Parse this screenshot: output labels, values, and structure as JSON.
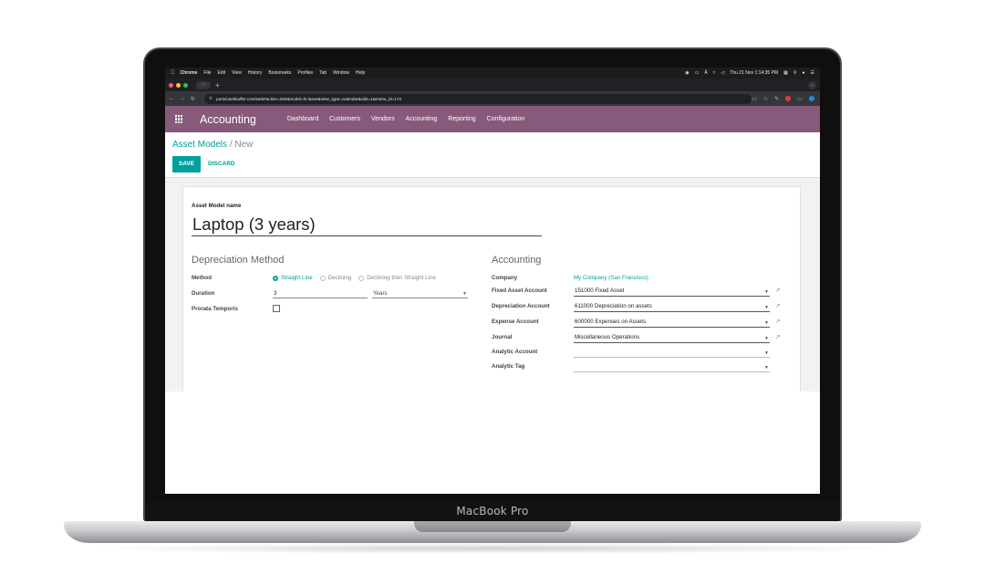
{
  "device": {
    "brand": "MacBook Pro"
  },
  "macos_menubar": {
    "apple_icon": "apple-icon",
    "items": [
      "Chrome",
      "File",
      "Edit",
      "View",
      "History",
      "Bookmarks",
      "Profiles",
      "Tab",
      "Window",
      "Help"
    ],
    "clock": "Thu 21 Nov 1:14:35 PM"
  },
  "browser": {
    "new_tab_symbol": "+",
    "url": "portal.webkuffer.com/web#action=262&model=hr.leave&view_type=calendar&cids=1&menu_id=173"
  },
  "navbar": {
    "app_name": "Accounting",
    "menu": [
      "Dashboard",
      "Customers",
      "Vendors",
      "Accounting",
      "Reporting",
      "Configuration"
    ],
    "accent_color": "#875a7b"
  },
  "control_panel": {
    "breadcrumb_root": "Asset Models",
    "breadcrumb_sep": "/",
    "breadcrumb_current": "New",
    "save_label": "SAVE",
    "discard_label": "DISCARD",
    "primary_color": "#00a09d"
  },
  "form": {
    "name_label": "Asset Model name",
    "name_value": "Laptop (3 years)",
    "depreciation": {
      "title": "Depreciation Method",
      "method_label": "Method",
      "method_options": [
        "Straight Line",
        "Declining",
        "Declining then Straight Line"
      ],
      "method_selected": "Straight Line",
      "duration_label": "Duration",
      "duration_value": "3",
      "duration_unit": "Years",
      "prorata_label": "Prorata Temporis",
      "prorata_checked": false
    },
    "accounting": {
      "title": "Accounting",
      "company_label": "Company",
      "company_value": "My Company (San Francisco)",
      "fixed_asset_label": "Fixed Asset Account",
      "fixed_asset_value": "151000 Fixed Asset",
      "depreciation_account_label": "Depreciation Account",
      "depreciation_account_value": "611000 Depreciation on assets",
      "expense_label": "Expense Account",
      "expense_value": "600000 Expenses on Assets",
      "journal_label": "Journal",
      "journal_value": "Miscellaneous Operations",
      "analytic_account_label": "Analytic Account",
      "analytic_account_value": "",
      "analytic_tag_label": "Analytic Tag",
      "analytic_tag_value": ""
    }
  }
}
